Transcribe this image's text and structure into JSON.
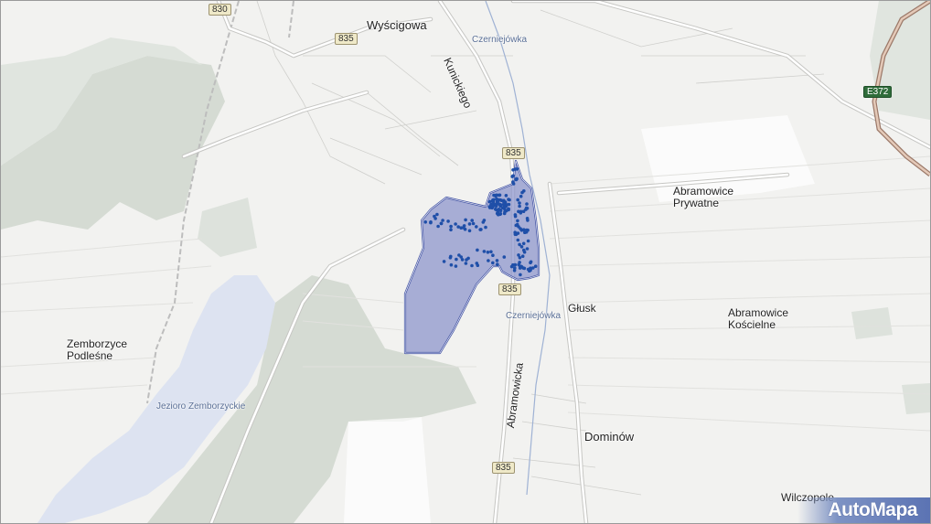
{
  "map": {
    "places": [
      {
        "id": "wyscigowa",
        "text": "Wyścigowa",
        "big": true
      },
      {
        "id": "abramowice-prywatne",
        "text": "Abramowice\nPrywatne"
      },
      {
        "id": "glusk",
        "text": "Głusk"
      },
      {
        "id": "abramowice-koscielne",
        "text": "Abramowice\nKościelne"
      },
      {
        "id": "zemborzyce-podlesne",
        "text": "Zemborzyce\nPodleśne"
      },
      {
        "id": "dominow",
        "text": "Dominów",
        "big": true
      },
      {
        "id": "wilczopole",
        "text": "Wilczopole"
      }
    ],
    "water_labels": [
      {
        "id": "czerniejowka-north",
        "text": "Czerniejówka"
      },
      {
        "id": "czerniejowka-south",
        "text": "Czerniejówka"
      },
      {
        "id": "jezioro",
        "text": "Jezioro Zemborzyckie"
      }
    ],
    "streets": [
      {
        "id": "kunickiego",
        "text": "Kunickiego"
      },
      {
        "id": "abramowicka",
        "text": "Abramowicka"
      }
    ],
    "road_shields": [
      {
        "id": "r830",
        "text": "830"
      },
      {
        "id": "r835-north",
        "text": "835"
      },
      {
        "id": "r835-mid",
        "text": "835"
      },
      {
        "id": "r835-poly",
        "text": "835"
      },
      {
        "id": "r835-south",
        "text": "835"
      }
    ],
    "euro_shield": {
      "text": "E372"
    },
    "highlight_color": "#4a5aa8",
    "highlight_fill": "#8e95cc",
    "point_color": "#1f4fa8",
    "water_color": "#dde3f1",
    "forest_color": "#d5dbd3"
  },
  "brand": {
    "text": "AutoMapa"
  }
}
